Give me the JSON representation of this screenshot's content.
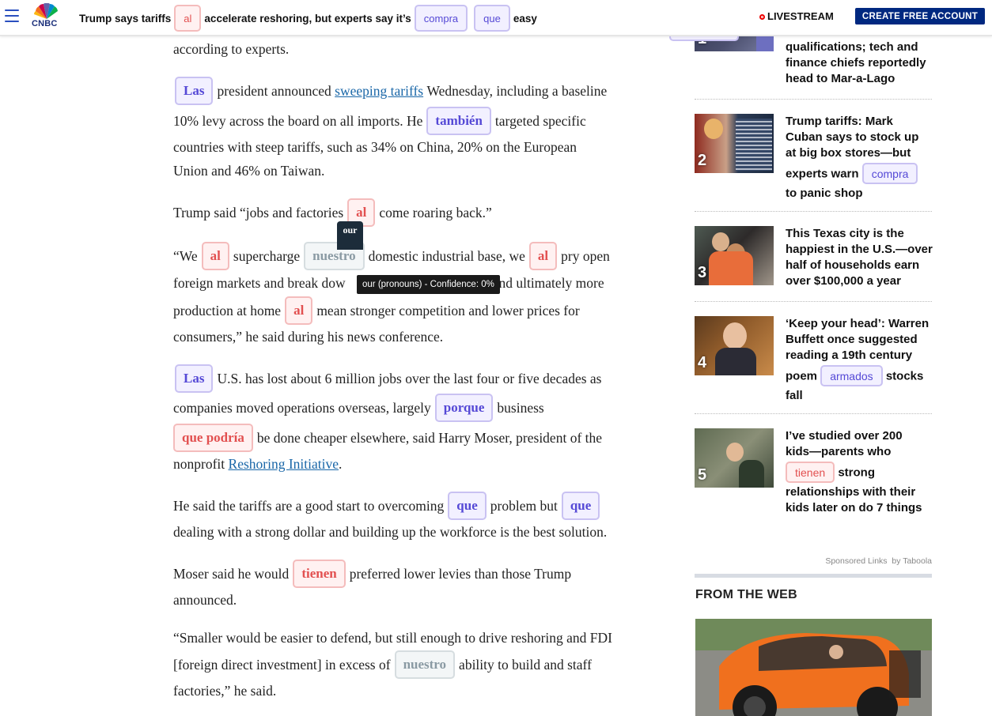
{
  "header": {
    "logo_text": "CNBC",
    "headline_parts": [
      {
        "text": "Trump says tariffs",
        "chip": null
      },
      {
        "text": "al",
        "chip": "red"
      },
      {
        "text": "accelerate reshoring, but experts say it’s",
        "chip": null
      },
      {
        "text": "compra",
        "chip": "blue"
      },
      {
        "text": "que",
        "chip": "blue"
      },
      {
        "text": "easy",
        "chip": null
      }
    ],
    "livestream_label": "LIVESTREAM",
    "create_account_label": "CREATE FREE ACCOUNT"
  },
  "article": {
    "l0": "according to experts.",
    "p1": {
      "chip1": "Las",
      "t1": "president announced",
      "link": "sweeping tariffs",
      "t2": "Wednesday, including a baseline",
      "t3": "10% levy across the board on all imports. He",
      "chip2": "también",
      "t4": "targeted specific",
      "t5": "countries with steep tariffs, such as 34% on China, 20% on the European",
      "t6": "Union and 46% on Taiwan."
    },
    "p2": {
      "t1": "Trump said “jobs and factories",
      "chip": "al",
      "t2": "come roaring back.”"
    },
    "p3": {
      "t1": "“We",
      "chip1": "al",
      "t2": "supercharge",
      "chip2": "nuestro",
      "t3": "domestic industrial base, we",
      "chip3": "al",
      "t4": "pry open",
      "t5": "foreign markets and break dow",
      "t6": "and ultimately more",
      "t7": "production at home",
      "chip4": "al",
      "t8": "mean stronger competition and lower prices for",
      "t9": "consumers,” he said during his news conference."
    },
    "tooltip_badge": "our",
    "tooltip_text": "our (pronouns) - Confidence: 0%",
    "p4": {
      "chip1": "Las",
      "t1": "U.S. has lost about 6 million jobs over the last four or five decades as",
      "t2": "companies moved operations overseas, largely",
      "chip2": "porque",
      "t3": "business",
      "chip3": "que podría",
      "t4": "be done cheaper elsewhere, said Harry Moser, president of the",
      "t5": "nonprofit",
      "link": "Reshoring Initiative",
      "t6": "."
    },
    "p5": {
      "t1": "He said the tariffs are a good start to overcoming",
      "chip1": "que",
      "t2": "problem but",
      "chip2": "que",
      "t3": "dealing with a strong dollar and building up the workforce is the best solution."
    },
    "p6": {
      "t1": "Moser said he would",
      "chip": "tienen",
      "t2": "preferred lower levies than those Trump",
      "t3": "announced."
    },
    "p7": {
      "t1": "“Smaller would be easier to defend, but still enough to drive reshoring and FDI",
      "t2": "[foreign direct investment] in excess of",
      "chip": "nuestro",
      "t3": "ability to build and staff",
      "t4": "factories,” he said."
    }
  },
  "sidebar": {
    "items": [
      {
        "num": "1",
        "lines": [
          "qualifications; tech and",
          "finance chiefs reportedly",
          "head to Mar-a-Lago"
        ]
      },
      {
        "num": "2",
        "l1": "Trump tariffs: Mark",
        "l2": "Cuban says to stock up",
        "l3": "at big box stores—but",
        "l4": "experts warn",
        "chip": "compra",
        "l5": "to panic shop"
      },
      {
        "num": "3",
        "lines": [
          "This Texas city is the",
          "happiest in the U.S.—over",
          "half of households earn",
          "over $100,000 a year"
        ]
      },
      {
        "num": "4",
        "l1": "‘Keep your head’: Warren",
        "l2": "Buffett once suggested",
        "l3": "reading a 19th century",
        "l4": "poem",
        "chip": "armados",
        "l5": "stocks",
        "l6": "fall"
      },
      {
        "num": "5",
        "l1": "I’ve studied over 200",
        "l2": "kids—parents who",
        "chip": "tienen",
        "l3": "strong",
        "l4": "relationships with their",
        "l5": "kids later on do 7 things"
      }
    ],
    "sponsored": "Sponsored Links",
    "taboola": "by Taboola",
    "from_the_web": "FROM THE WEB"
  },
  "colors": {
    "red_chip": "#e25050",
    "blue_chip": "#5549d6",
    "gray_chip": "#8a9aa3",
    "brand_button": "#002880",
    "link": "#1a67a8"
  }
}
